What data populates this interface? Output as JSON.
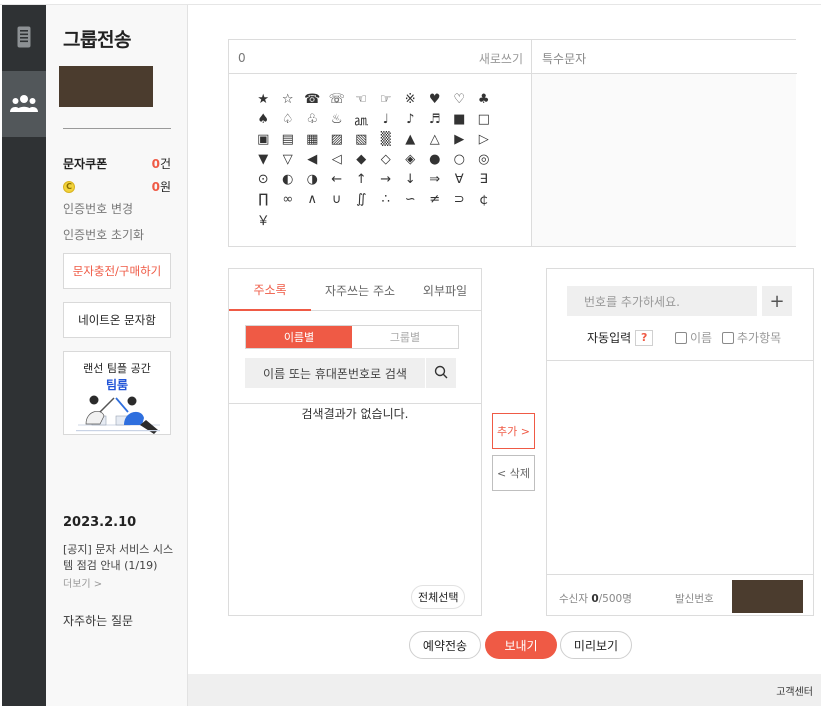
{
  "side": {
    "title": "그룹전송",
    "coupon_label": "문자쿠폰",
    "coupon_count": "0",
    "coupon_unit": "건",
    "coin_symbol": "C",
    "balance": "0",
    "balance_unit": "원",
    "change_auth": "인증번호 변경",
    "reset_auth": "인증번호 초기화",
    "charge_button": "문자충전/구매하기",
    "nateon_button": "네이트온 문자함",
    "promo_line1": "랜선 팀플 공간",
    "promo_line2": "팀룸",
    "notice_date": "2023.2.10",
    "notice_text": "[공지] 문자 서비스 시스템 점검 안내 (1/19)",
    "more": "더보기 >",
    "faq": "자주하는 질문"
  },
  "composer": {
    "char_count": "0",
    "new_label": "새로쓰기",
    "special_title": "특수문자",
    "symbols": [
      "★",
      "☆",
      "☎",
      "☏",
      "☜",
      "☞",
      "※",
      "♥",
      "♡",
      "♣",
      "♠",
      "♤",
      "♧",
      "♨",
      "㏂",
      "♩",
      "♪",
      "♬",
      "■",
      "□",
      "▣",
      "▤",
      "▦",
      "▨",
      "▧",
      "▒",
      "▲",
      "△",
      "▶",
      "▷",
      "▼",
      "▽",
      "◀",
      "◁",
      "◆",
      "◇",
      "◈",
      "●",
      "○",
      "◎",
      "⊙",
      "◐",
      "◑",
      "←",
      "↑",
      "→",
      "↓",
      "⇒",
      "∀",
      "∃",
      "∏",
      "∞",
      "∧",
      "∪",
      "∬",
      "∴",
      "∽",
      "≠",
      "⊃",
      "￠",
      "￥"
    ]
  },
  "address": {
    "tabs": [
      "주소록",
      "자주쓰는 주소",
      "외부파일"
    ],
    "toggle_by_name": "이름별",
    "toggle_by_group": "그룹별",
    "search_label": "이름 또는 휴대폰번호로 검색",
    "no_result": "검색결과가 없습니다.",
    "select_all": "전체선택"
  },
  "middle": {
    "add": "추가 >",
    "remove": "< 삭제"
  },
  "recipients": {
    "placeholder": "번호를 추가하세요.",
    "plus": "+",
    "auto_input": "자동입력",
    "help": "?",
    "opt_name": "이름",
    "opt_extra": "추가항목",
    "count_label": "수신자",
    "count": "0",
    "count_max": "/500명",
    "sender_label": "발신번호"
  },
  "actions": {
    "reserve": "예약전송",
    "send": "보내기",
    "preview": "미리보기"
  },
  "footer": {
    "support": "고객센터"
  },
  "colors": {
    "accent": "#ef5a45",
    "rail": "#2f3234",
    "promo_blue": "#2255d8"
  }
}
